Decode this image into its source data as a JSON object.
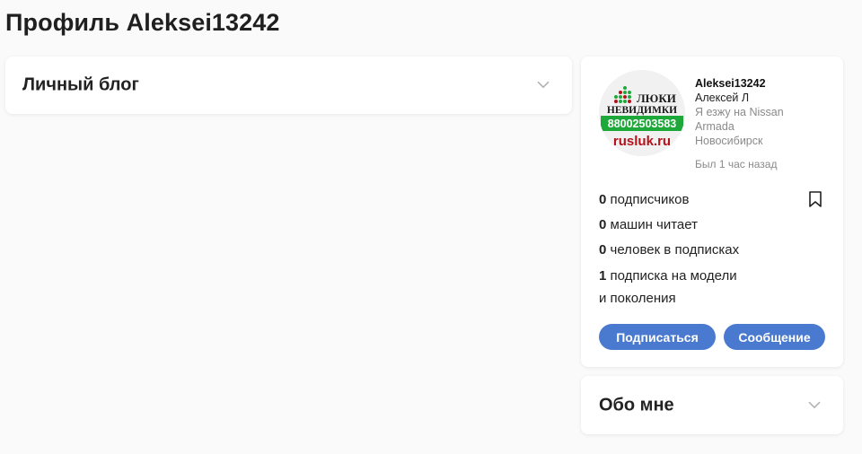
{
  "page": {
    "title": "Профиль Aleksei13242"
  },
  "blog": {
    "title": "Личный блог"
  },
  "profile": {
    "avatar": {
      "line1": "ЛЮКИ",
      "line2": "НЕВИДИМКИ",
      "phone": "88002503583",
      "site": "rusluk.ru"
    },
    "nickname": "Aleksei13242",
    "real_name": "Алексей Л",
    "car_line1": "Я езжу на Nissan",
    "car_line2": "Armada",
    "city": "Новосибирск",
    "last_seen": "Был 1 час назад",
    "stats": {
      "followers_count": "0",
      "followers_label": "подписчиков",
      "cars_count": "0",
      "cars_label": "машин читает",
      "following_count": "0",
      "following_label": "человек в подписках",
      "models_count": "1",
      "models_label_1": "подписка на модели",
      "models_label_2": "и поколения"
    },
    "subscribe_label": "Подписаться",
    "message_label": "Сообщение"
  },
  "about": {
    "title": "Обо мне"
  },
  "colors": {
    "accent": "#4a7ad0",
    "logo_green": "#1fa83a",
    "logo_red": "#b5121b"
  },
  "icons": {
    "chevron": "chevron-down-icon",
    "bookmark": "bookmark-icon"
  }
}
